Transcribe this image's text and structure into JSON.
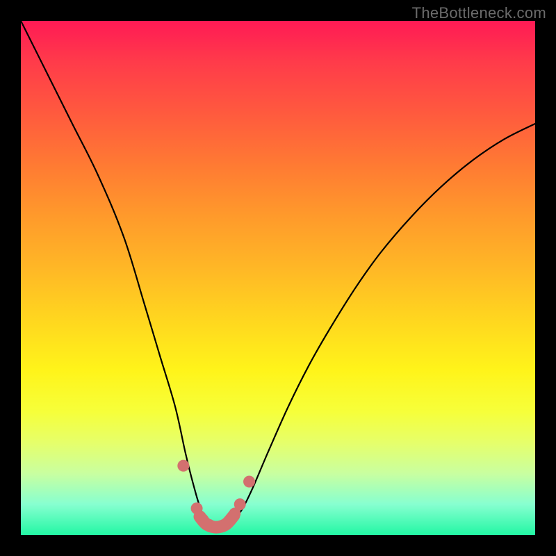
{
  "watermark": "TheBottleneck.com",
  "colors": {
    "frame_bg": "#000000",
    "curve": "#000000",
    "marker": "#d3706f",
    "gradient_top": "#ff1a55",
    "gradient_bottom": "#22f7a4"
  },
  "chart_data": {
    "type": "line",
    "title": "",
    "xlabel": "",
    "ylabel": "",
    "xlim": [
      0,
      100
    ],
    "ylim": [
      0,
      100
    ],
    "grid": false,
    "legend": false,
    "annotations": [
      "TheBottleneck.com"
    ],
    "series": [
      {
        "name": "bottleneck-curve",
        "x": [
          0,
          5,
          10,
          15,
          20,
          24,
          27,
          30,
          32,
          33.5,
          35,
          36.5,
          38,
          39.5,
          41,
          43,
          45,
          48,
          52,
          56,
          60,
          65,
          70,
          76,
          82,
          88,
          94,
          100
        ],
        "y": [
          100,
          90,
          80,
          70,
          58,
          45,
          35,
          25,
          16,
          10,
          5,
          2.5,
          1.5,
          1.5,
          2.5,
          5,
          9,
          16,
          25,
          33,
          40,
          48,
          55,
          62,
          68,
          73,
          77,
          80
        ]
      }
    ],
    "highlighted_points": {
      "name": "salmon-markers",
      "x": [
        31.6,
        34.2,
        35.4,
        36.6,
        38.2,
        40.2,
        41.6,
        42.6,
        44.4
      ],
      "y": [
        13.5,
        5.2,
        3.0,
        2.0,
        1.6,
        2.4,
        4.2,
        6.0,
        10.4
      ]
    },
    "highlighted_segment": {
      "x": [
        34.8,
        36.0,
        37.4,
        38.6,
        40.0,
        41.4
      ],
      "y": [
        3.6,
        2.2,
        1.6,
        1.6,
        2.2,
        3.8
      ]
    }
  }
}
